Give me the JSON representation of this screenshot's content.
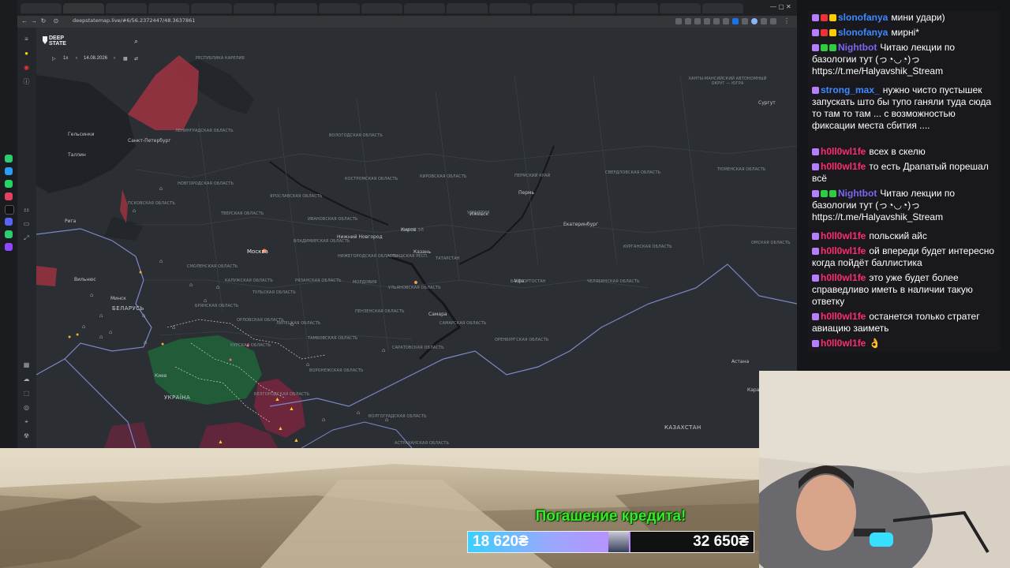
{
  "browser": {
    "url": "deepstatemap.live/#6/56.2372447/48.3637861"
  },
  "map_app": {
    "logo_line1": "DEEP",
    "logo_line2": "STATE",
    "speed": "1x",
    "date": "14.08.2026",
    "labels": {
      "cities": [
        {
          "text": "Санкт-Петербург"
        },
        {
          "text": "Москва"
        },
        {
          "text": "Казань"
        },
        {
          "text": "Самара"
        },
        {
          "text": "Екатеринбург"
        },
        {
          "text": "Пермь"
        },
        {
          "text": "Нижний Новгород"
        },
        {
          "text": "Вильнюс"
        },
        {
          "text": "Минск"
        },
        {
          "text": "Рига"
        },
        {
          "text": "Таллин"
        },
        {
          "text": "Гельсинки"
        },
        {
          "text": "Киев"
        },
        {
          "text": "Сургут"
        },
        {
          "text": "Астана"
        },
        {
          "text": "Караганда"
        },
        {
          "text": "Уфа"
        },
        {
          "text": "Ижевск"
        },
        {
          "text": "Киров"
        }
      ],
      "countries": [
        {
          "text": "БЕЛАРУСЬ"
        },
        {
          "text": "УКРАЇНА"
        },
        {
          "text": "КАЗАХСТАН"
        }
      ],
      "regions": [
        {
          "text": "РЕСПУБЛИКА КАРЕЛИЯ"
        },
        {
          "text": "ЛЕНИНГРАДСКАЯ ОБЛАСТЬ"
        },
        {
          "text": "ВОЛОГОДСКАЯ ОБЛАСТЬ"
        },
        {
          "text": "НОВГОРОДСКАЯ ОБЛАСТЬ"
        },
        {
          "text": "ПСКОВСКАЯ ОБЛАСТЬ"
        },
        {
          "text": "ТВЕРСКАЯ ОБЛАСТЬ"
        },
        {
          "text": "ЯРОСЛАВСКАЯ ОБЛАСТЬ"
        },
        {
          "text": "КОСТРОМСКАЯ ОБЛАСТЬ"
        },
        {
          "text": "ИВАНОВСКАЯ ОБЛАСТЬ"
        },
        {
          "text": "ВЛАДИМИРСКАЯ ОБЛАСТЬ"
        },
        {
          "text": "СМОЛЕНСКАЯ ОБЛАСТЬ"
        },
        {
          "text": "КАЛУЖСКАЯ ОБЛАСТЬ"
        },
        {
          "text": "ТУЛЬСКАЯ ОБЛАСТЬ"
        },
        {
          "text": "РЯЗАНСКАЯ ОБЛАСТЬ"
        },
        {
          "text": "БРЯНСКАЯ ОБЛАСТЬ"
        },
        {
          "text": "ОРЛОВСКАЯ ОБЛАСТЬ"
        },
        {
          "text": "ЛИПЕЦКАЯ ОБЛАСТЬ"
        },
        {
          "text": "ТАМБОВСКАЯ ОБЛАСТЬ"
        },
        {
          "text": "ПЕНЗЕНСКАЯ ОБЛАСТЬ"
        },
        {
          "text": "МОРДОВИЯ"
        },
        {
          "text": "НИЖЕГОРОДСКАЯ ОБЛАСТЬ"
        },
        {
          "text": "ЧУВАШСКАЯ РЕСП."
        },
        {
          "text": "МАРИЙ ЭЛ"
        },
        {
          "text": "ТАТАРСТАН"
        },
        {
          "text": "УЛЬЯНОВСКАЯ ОБЛАСТЬ"
        },
        {
          "text": "САМАРСКАЯ ОБЛАСТЬ"
        },
        {
          "text": "САРАТОВСКАЯ ОБЛАСТЬ"
        },
        {
          "text": "ОРЕНБУРГСКАЯ ОБЛАСТЬ"
        },
        {
          "text": "БАШКОРТОСТАН"
        },
        {
          "text": "ЧЕЛЯБИНСКАЯ ОБЛАСТЬ"
        },
        {
          "text": "КУРГАНСКАЯ ОБЛАСТЬ"
        },
        {
          "text": "ТЮМЕНСКАЯ ОБЛАСТЬ"
        },
        {
          "text": "СВЕРДЛОВСКАЯ ОБЛАСТЬ"
        },
        {
          "text": "ПЕРМСКИЙ КРАЙ"
        },
        {
          "text": "УДМУРТИЯ"
        },
        {
          "text": "КИРОВСКАЯ ОБЛАСТЬ"
        },
        {
          "text": "ХАНТЫ-МАНСИЙСКИЙ АВТОНОМНЫЙ ОКРУГ — ЮГРА"
        },
        {
          "text": "ВОРОНЕЖСКАЯ ОБЛАСТЬ"
        },
        {
          "text": "КУРСКАЯ ОБЛАСТЬ"
        },
        {
          "text": "БЕЛГОРОДСКАЯ ОБЛАСТЬ"
        },
        {
          "text": "ВОЛГОГРАДСКАЯ ОБЛАСТЬ"
        },
        {
          "text": "АСТРАХАНСКАЯ ОБЛАСТЬ"
        },
        {
          "text": "ОМСКАЯ ОБЛАСТЬ"
        }
      ]
    }
  },
  "chat": {
    "messages": [
      {
        "user": "slonofanya",
        "color": "#3d8bff",
        "badges": [
          "#b77dff",
          "#e33",
          "#fc0"
        ],
        "text": "мини удари)"
      },
      {
        "user": "slonofanya",
        "color": "#3d8bff",
        "badges": [
          "#b77dff",
          "#e33",
          "#fc0"
        ],
        "text": "мирні*"
      },
      {
        "user": "Nightbot",
        "color": "#7b68ee",
        "badges": [
          "#b77dff",
          "#2ecc40",
          "#2ecc40"
        ],
        "text": "Читаю лекции по базологии тут (っ◔◡◔)っ https://t.me/Halyavshik_Stream"
      },
      {
        "user": "strong_max_",
        "color": "#3d8bff",
        "badges": [
          "#b77dff"
        ],
        "text": "нужно чисто пустышек запускать што бы тупо ганяли туда сюда то там то там ... с возможностью фиксации места сбития ...."
      },
      {
        "user": "h0ll0wl1fe",
        "color": "#ff2d6f",
        "badges": [
          "#b77dff"
        ],
        "text": "всех в скелю"
      },
      {
        "user": "h0ll0wl1fe",
        "color": "#ff2d6f",
        "badges": [
          "#b77dff"
        ],
        "text": "то есть Драпатый порешал всё"
      },
      {
        "user": "Nightbot",
        "color": "#7b68ee",
        "badges": [
          "#b77dff",
          "#2ecc40",
          "#2ecc40"
        ],
        "text": "Читаю лекции по базологии тут (っ◔◡◔)っ https://t.me/Halyavshik_Stream"
      },
      {
        "user": "h0ll0wl1fe",
        "color": "#ff2d6f",
        "badges": [
          "#b77dff"
        ],
        "text": "польский айс"
      },
      {
        "user": "h0ll0wl1fe",
        "color": "#ff2d6f",
        "badges": [
          "#b77dff"
        ],
        "text": "ой впереди будет интересно когда пойдёт баллистика"
      },
      {
        "user": "h0ll0wl1fe",
        "color": "#ff2d6f",
        "badges": [
          "#b77dff"
        ],
        "text": "это уже будет более справедливо иметь в наличии такую ответку"
      },
      {
        "user": "h0ll0wl1fe",
        "color": "#ff2d6f",
        "badges": [
          "#b77dff"
        ],
        "text": "останется только стратег авиацию заиметь"
      },
      {
        "user": "h0ll0wl1fe",
        "color": "#ff2d6f",
        "badges": [
          "#b77dff"
        ],
        "text": "👌"
      }
    ]
  },
  "donation": {
    "title": "Погашение кредита!",
    "current": "18 620₴",
    "goal": "32 650₴",
    "progress": 0.57
  }
}
